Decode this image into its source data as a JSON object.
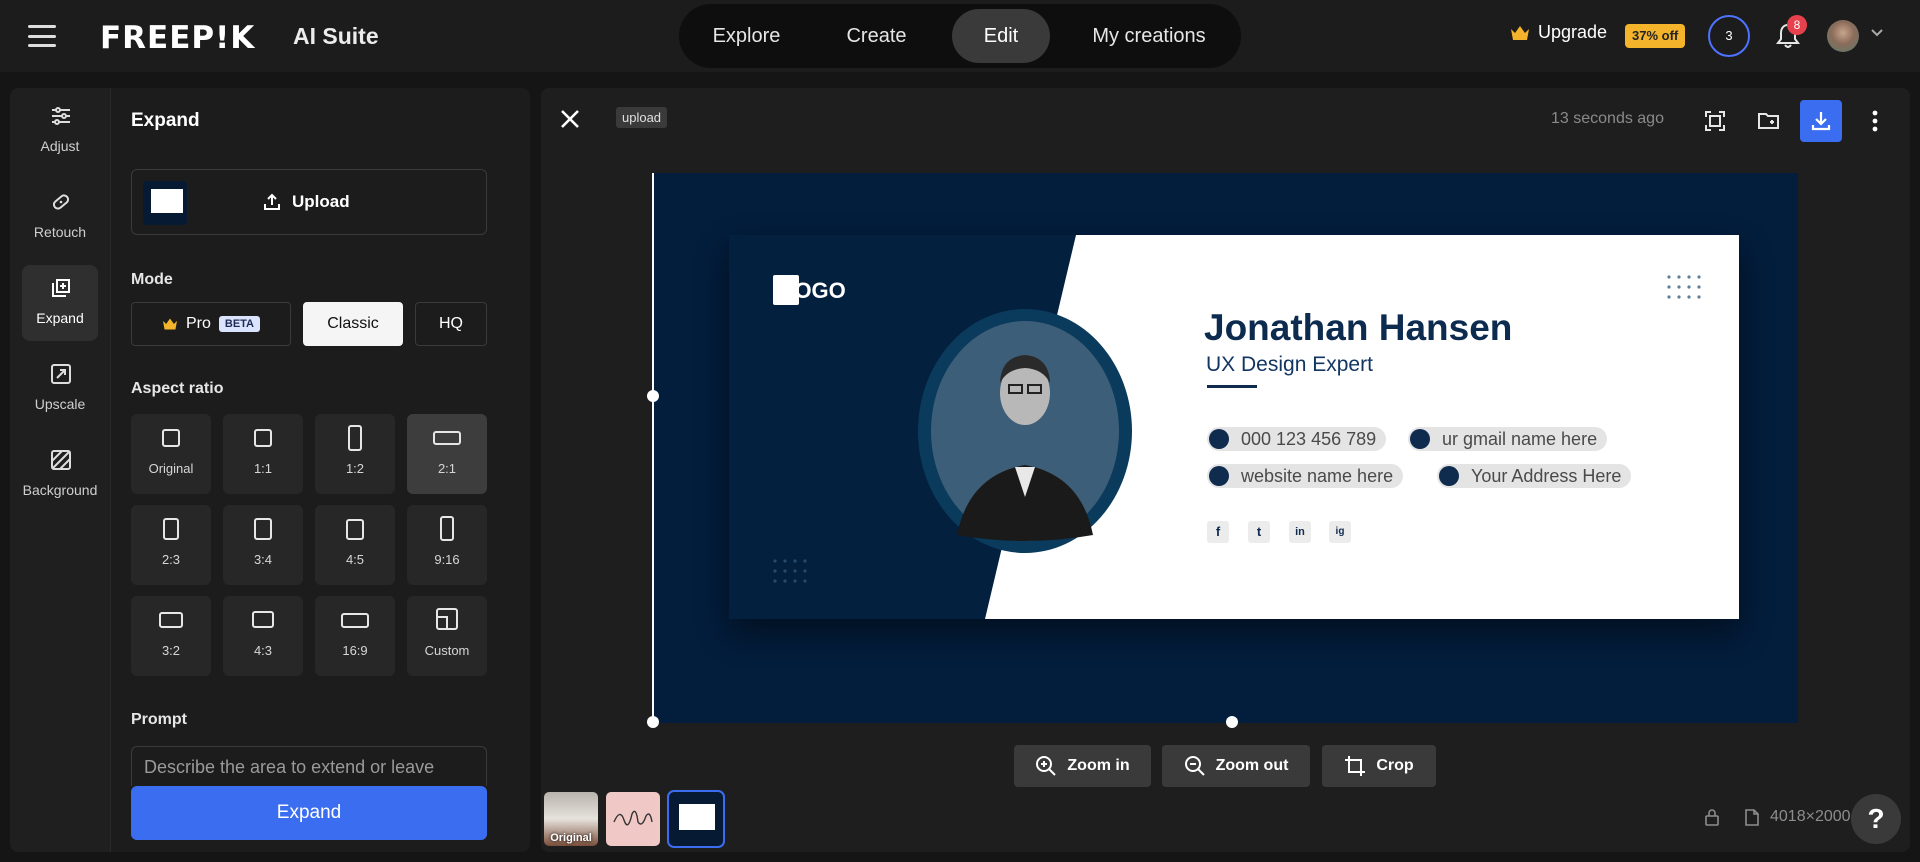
{
  "header": {
    "logo": "FREEP!K",
    "suite": "AI Suite",
    "tabs": [
      {
        "label": "Explore"
      },
      {
        "label": "Create"
      },
      {
        "label": "Edit",
        "active": true
      },
      {
        "label": "My creations"
      }
    ],
    "upgrade_label": "Upgrade",
    "discount": "37% off",
    "credits": "3",
    "notifications": "8",
    "accent": "#3b6df0"
  },
  "tools": [
    {
      "label": "Adjust",
      "icon": "sliders-icon"
    },
    {
      "label": "Retouch",
      "icon": "bandage-icon"
    },
    {
      "label": "Expand",
      "icon": "expand-icon",
      "active": true
    },
    {
      "label": "Upscale",
      "icon": "upscale-icon"
    },
    {
      "label": "Background",
      "icon": "background-icon"
    }
  ],
  "panel": {
    "title": "Expand",
    "upload_label": "Upload",
    "mode_title": "Mode",
    "modes": [
      {
        "label": "Pro",
        "badge": "BETA"
      },
      {
        "label": "Classic",
        "selected": true
      },
      {
        "label": "HQ"
      }
    ],
    "aspect_title": "Aspect ratio",
    "ratios": [
      "Original",
      "1:1",
      "1:2",
      "2:1",
      "2:3",
      "3:4",
      "4:5",
      "9:16",
      "3:2",
      "4:3",
      "16:9",
      "Custom"
    ],
    "selected_ratio": "2:1",
    "prompt_title": "Prompt",
    "prompt_placeholder": "Describe the area to extend or leave",
    "expand_button": "Expand"
  },
  "canvas": {
    "tag": "upload",
    "time": "13 seconds ago",
    "zoom_in": "Zoom in",
    "zoom_out": "Zoom out",
    "crop": "Crop",
    "thumb_original": "Original",
    "dimensions": "4018×2000",
    "help": "?"
  },
  "card": {
    "logo": "LOGO",
    "name": "Jonathan Hansen",
    "title": "UX Design Expert",
    "phone": "000 123 456 789",
    "email": "ur gmail name here",
    "website": "website name here",
    "address": "Your Address Here",
    "social": [
      "f",
      "t",
      "in",
      "ig"
    ]
  }
}
